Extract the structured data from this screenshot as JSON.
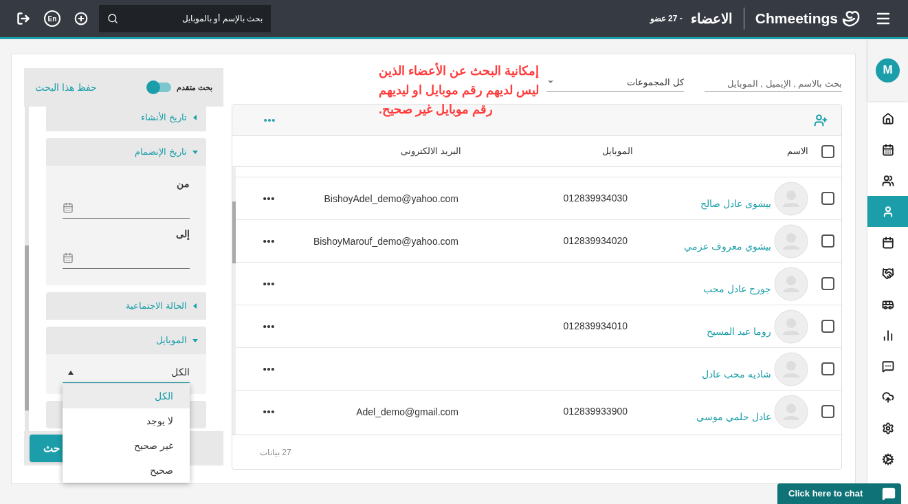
{
  "header": {
    "logo": "Chmeetings",
    "page_title": "الاعضاء",
    "count": "- 27 عضو",
    "search_placeholder": "بحث بالإسم أو بالموبايل",
    "language": "En"
  },
  "filters": {
    "search_placeholder": "بحث بالاسم , الإيميل , الموبايل",
    "group_select": "كل المجموعات"
  },
  "annotation": [
    "إمكانية البحث عن الأعضاء الذين",
    "ليس لديهم رقم موبايل او ليديهم",
    "رقم موبايل غير صحيح."
  ],
  "advanced": {
    "toggle_label": "بحث متقدم",
    "toggle_on": true,
    "save_link": "حفظ هذا البحث",
    "search_button": "حث",
    "sections": [
      {
        "kind": "group",
        "label": "تاريخ الأنشاء",
        "expanded": false
      },
      {
        "kind": "dates",
        "label": "تاريخ الإنضمام",
        "expanded": true,
        "fields": [
          {
            "label": "من"
          },
          {
            "label": "إلى"
          }
        ]
      },
      {
        "kind": "group",
        "label": "الحالة الاجتماعية",
        "expanded": false
      },
      {
        "kind": "select",
        "label": "الموبايل",
        "expanded": true,
        "value": "الكل"
      }
    ],
    "dropdown": [
      {
        "label": "الكل",
        "selected": true
      },
      {
        "label": "لا يوجد",
        "selected": false
      },
      {
        "label": "غير صحيح",
        "selected": false
      },
      {
        "label": "صحيح",
        "selected": false
      }
    ]
  },
  "table": {
    "all_checked": false,
    "columns": [
      "الاسم",
      "الموبايل",
      "البريد الالكترونى"
    ],
    "rows": [
      {
        "name": "بيشوى عادل صالح",
        "mobile": "012839934030",
        "email": "BishoyAdel_demo@yahoo.com",
        "checked": false
      },
      {
        "name": "بيشوي معروف عزمي",
        "mobile": "012839934020",
        "email": "BishoyMarouf_demo@yahoo.com",
        "checked": false
      },
      {
        "name": "جورج عادل محب",
        "checked": false
      },
      {
        "name": "روما عبد المسيح",
        "mobile": "012839934010",
        "checked": false
      },
      {
        "name": "شاديه محب عادل",
        "checked": false
      },
      {
        "name": "عادل حلمي موسي",
        "mobile": "012839933900",
        "email": "Adel_demo@gmail.com",
        "checked": false
      }
    ],
    "footer": "27 بيانات"
  },
  "sidebar": {
    "avatar": "M",
    "items": [
      {
        "selected": false
      },
      {
        "selected": false
      },
      {
        "selected": false
      },
      {
        "selected": true
      },
      {
        "selected": false
      },
      {
        "selected": false
      },
      {
        "selected": false
      },
      {
        "selected": false
      },
      {
        "selected": false
      },
      {
        "selected": false
      },
      {
        "selected": false
      },
      {
        "selected": false
      }
    ]
  },
  "chat": {
    "label": "Click here to chat"
  }
}
